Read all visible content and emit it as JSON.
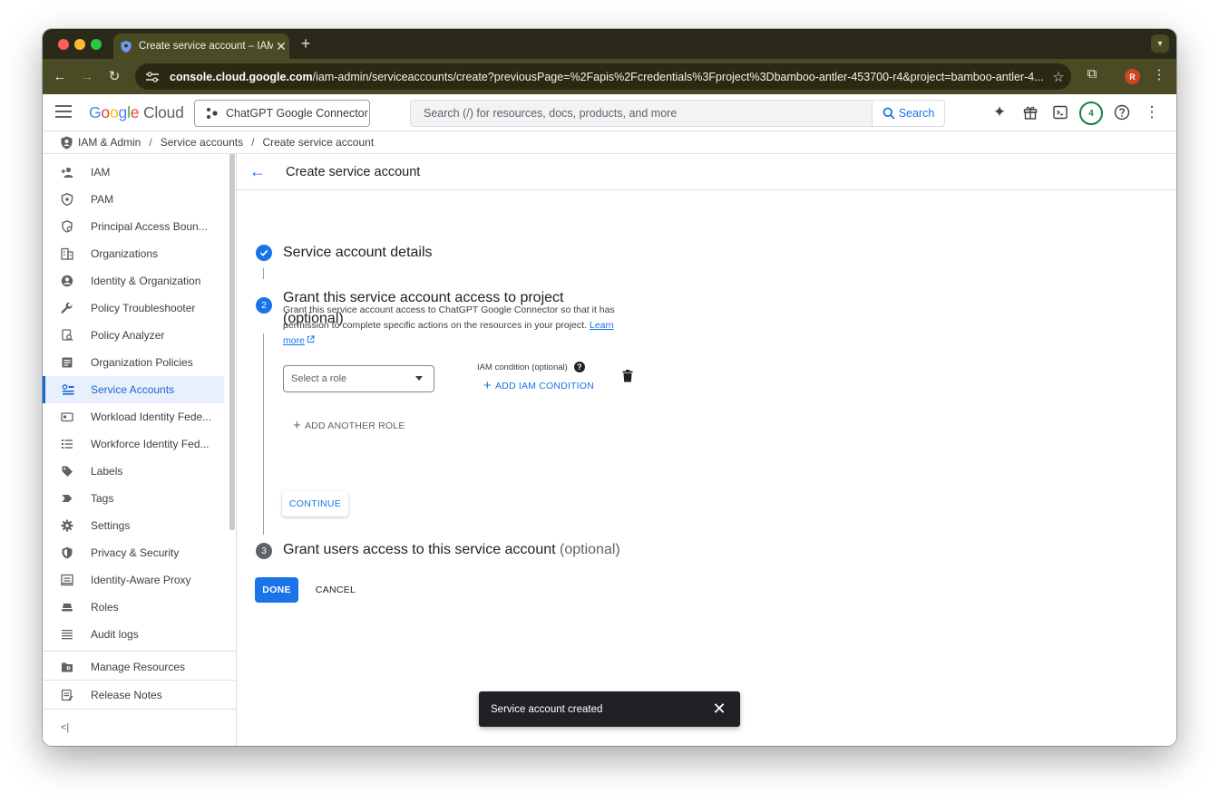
{
  "browser": {
    "tab_title": "Create service account – IAM",
    "tab_close": "✕",
    "new_tab": "+",
    "url_host": "console.cloud.google.com",
    "url_path": "/iam-admin/serviceaccounts/create?previousPage=%2Fapis%2Fcredentials%3Fproject%3Dbamboo-antler-453700-r4&project=bamboo-antler-4...",
    "profile_initial": "R"
  },
  "header": {
    "logo_letters": [
      "G",
      "o",
      "o",
      "g",
      "l",
      "e"
    ],
    "logo_product": "Cloud",
    "project_name": "ChatGPT Google Connector",
    "search_placeholder": "Search (/) for resources, docs, products, and more",
    "search_button": "Search",
    "notification_count": "4"
  },
  "breadcrumb": {
    "items": [
      "IAM & Admin",
      "Service accounts",
      "Create service account"
    ],
    "separator": "/"
  },
  "sidebar": {
    "items": [
      {
        "label": "IAM",
        "icon": "person-add-icon"
      },
      {
        "label": "PAM",
        "icon": "shield-icon"
      },
      {
        "label": "Principal Access Boun...",
        "icon": "policy-icon"
      },
      {
        "label": "Organizations",
        "icon": "building-icon"
      },
      {
        "label": "Identity & Organization",
        "icon": "account-circle-icon"
      },
      {
        "label": "Policy Troubleshooter",
        "icon": "wrench-icon"
      },
      {
        "label": "Policy Analyzer",
        "icon": "analyzer-icon"
      },
      {
        "label": "Organization Policies",
        "icon": "list-box-icon"
      },
      {
        "label": "Service Accounts",
        "icon": "service-account-icon"
      },
      {
        "label": "Workload Identity Fede...",
        "icon": "id-card-icon"
      },
      {
        "label": "Workforce Identity Fed...",
        "icon": "list-icon"
      },
      {
        "label": "Labels",
        "icon": "tag-icon"
      },
      {
        "label": "Tags",
        "icon": "label-chevron-icon"
      },
      {
        "label": "Settings",
        "icon": "gear-icon"
      },
      {
        "label": "Privacy & Security",
        "icon": "shield-check-icon"
      },
      {
        "label": "Identity-Aware Proxy",
        "icon": "proxy-icon"
      },
      {
        "label": "Roles",
        "icon": "roles-icon"
      },
      {
        "label": "Audit logs",
        "icon": "lines-icon"
      }
    ],
    "bottom_items": [
      {
        "label": "Manage Resources",
        "icon": "folder-gear-icon"
      },
      {
        "label": "Release Notes",
        "icon": "notes-icon"
      }
    ],
    "active_label": "Service Accounts",
    "collapse_glyph": "<|"
  },
  "page": {
    "title": "Create service account",
    "step1": {
      "title": "Service account details"
    },
    "step2": {
      "number": "2",
      "title": "Grant this service account access to project",
      "optional": "(optional)",
      "description": "Grant this service account access to ChatGPT Google Connector so that it has permission to complete specific actions on the resources in your project.",
      "learn_more": "Learn more",
      "role_placeholder": "Select a role",
      "iam_condition_label": "IAM condition (optional)",
      "add_condition": "ADD IAM CONDITION",
      "add_role": "ADD ANOTHER ROLE",
      "continue": "CONTINUE"
    },
    "step3": {
      "number": "3",
      "title": "Grant users access to this service account",
      "optional": "(optional)"
    },
    "done": "DONE",
    "cancel": "CANCEL"
  },
  "snackbar": {
    "message": "Service account created",
    "close": "✕"
  },
  "colors": {
    "accent": "#1a73e8",
    "active_bg": "#e8f0fe",
    "step_inactive": "#5f6368",
    "snackbar_bg": "#202124"
  }
}
